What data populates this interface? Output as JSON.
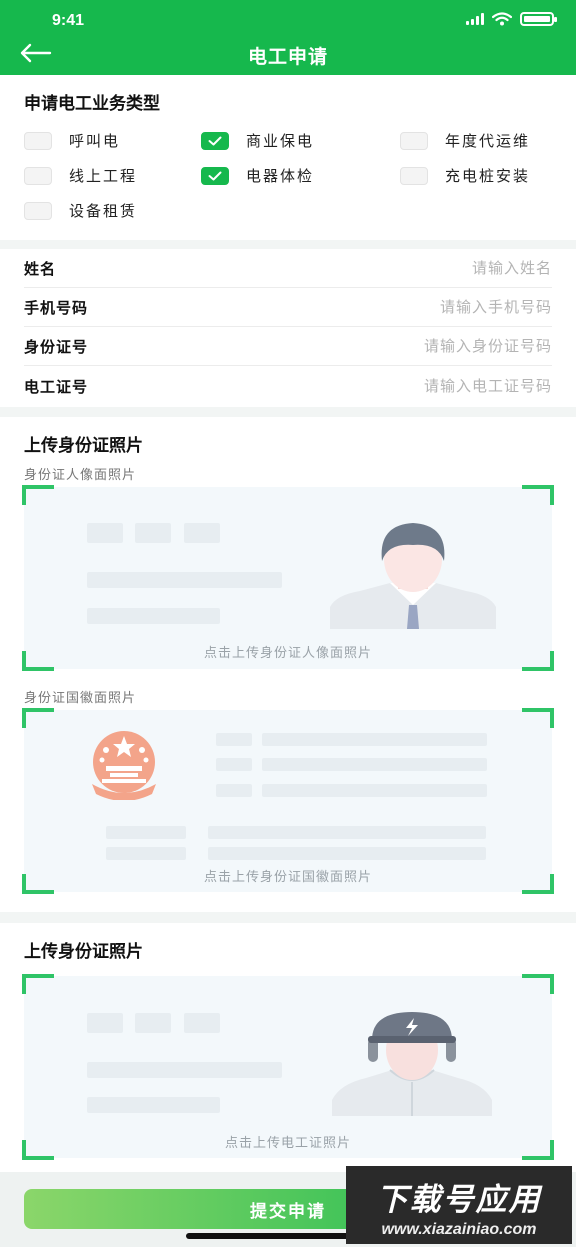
{
  "status_bar": {
    "time": "9:41"
  },
  "header": {
    "title": "电工申请"
  },
  "business_section": {
    "title": "申请电工业务类型",
    "options": [
      {
        "label": "呼叫电",
        "checked": false
      },
      {
        "label": "商业保电",
        "checked": true
      },
      {
        "label": "年度代运维",
        "checked": false
      },
      {
        "label": "线上工程",
        "checked": false
      },
      {
        "label": "电器体检",
        "checked": true
      },
      {
        "label": "充电桩安装",
        "checked": false
      },
      {
        "label": "设备租赁",
        "checked": false
      }
    ]
  },
  "form": {
    "fields": [
      {
        "label": "姓名",
        "placeholder": "请输入姓名"
      },
      {
        "label": "手机号码",
        "placeholder": "请输入手机号码"
      },
      {
        "label": "身份证号",
        "placeholder": "请输入身份证号码"
      },
      {
        "label": "电工证号",
        "placeholder": "请输入电工证号码"
      }
    ]
  },
  "id_upload": {
    "title": "上传身份证照片",
    "front_label": "身份证人像面照片",
    "front_hint": "点击上传身份证人像面照片",
    "back_label": "身份证国徽面照片",
    "back_hint": "点击上传身份证国徽面照片"
  },
  "cert_upload": {
    "title": "上传身份证照片",
    "hint": "点击上传电工证照片"
  },
  "submit": {
    "label": "提交申请"
  },
  "watermark": {
    "logo": "下载号应用",
    "url": "www.xiazainiao.com"
  },
  "colors": {
    "primary": "#16b84d",
    "corner": "#2fc467",
    "emblem": "#f3a48a"
  }
}
